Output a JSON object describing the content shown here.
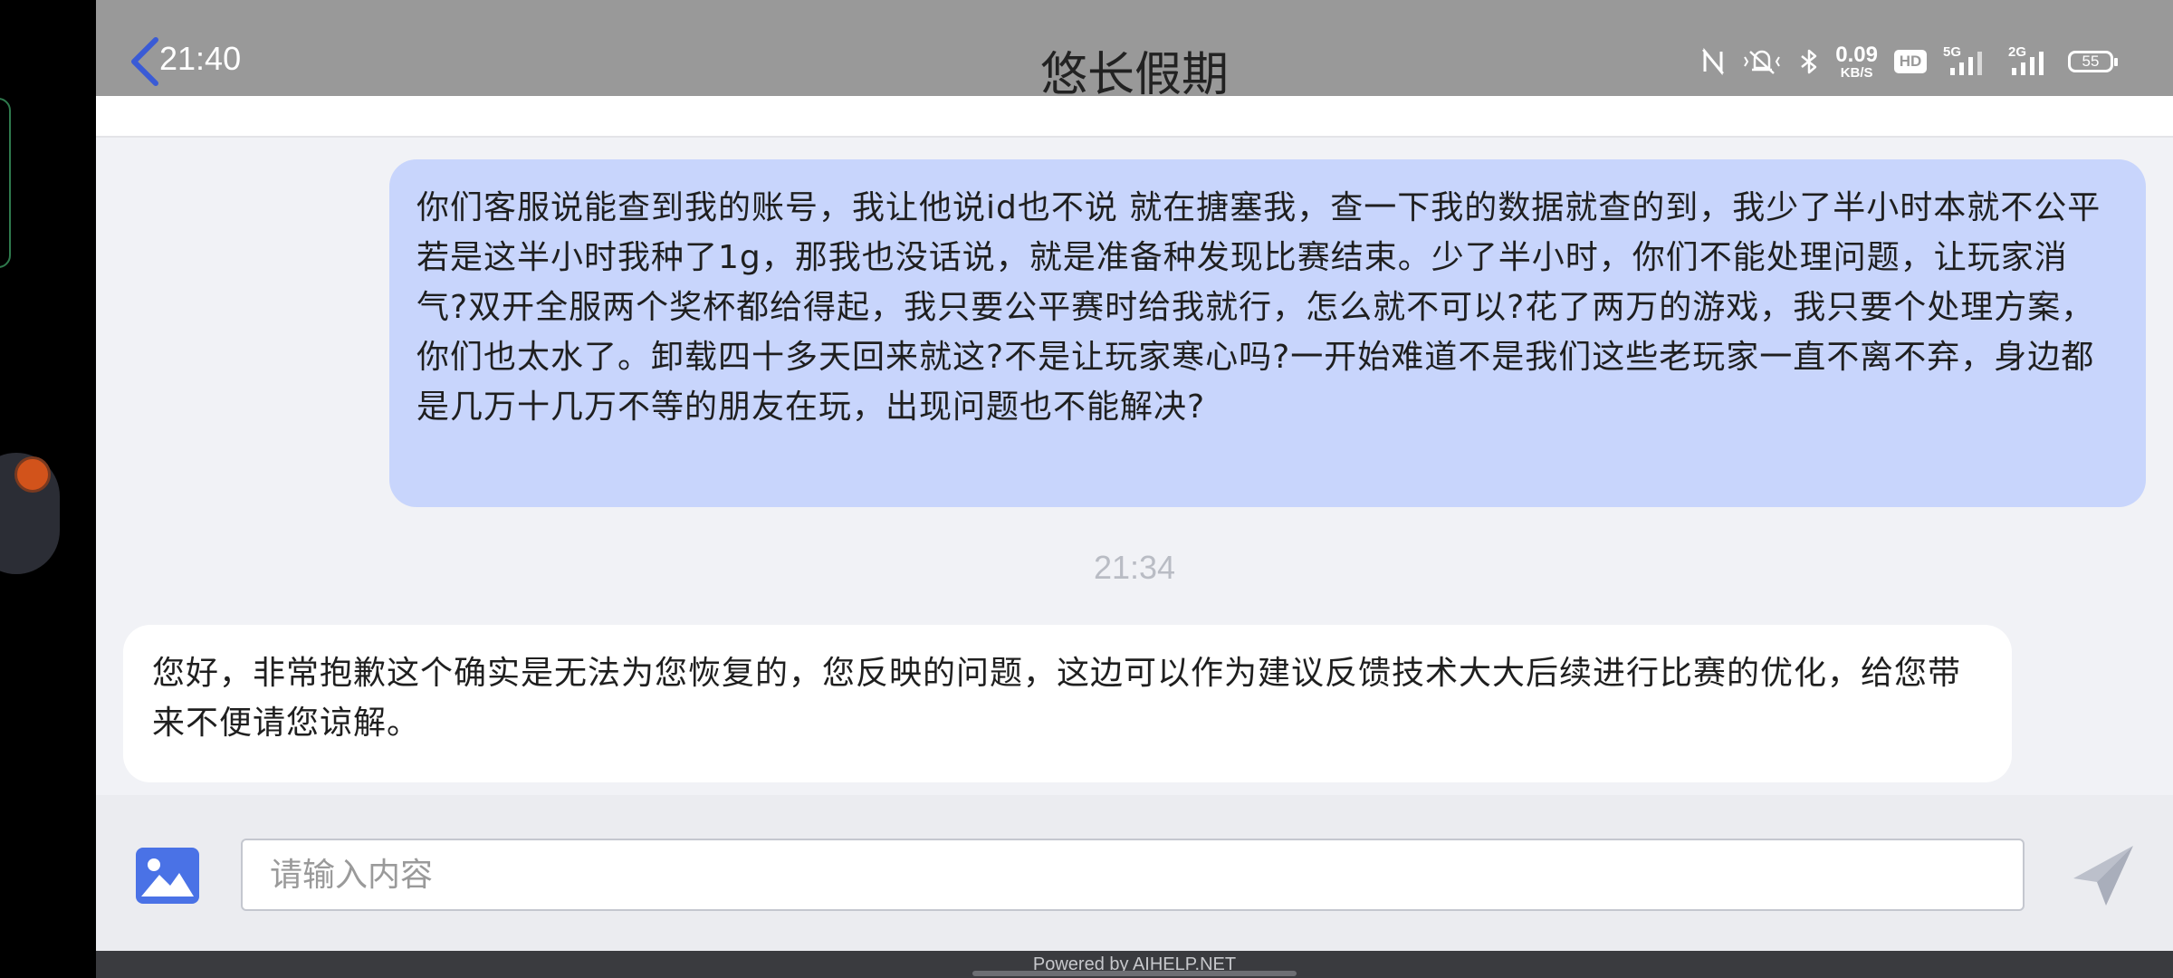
{
  "status_bar": {
    "time": "21:40",
    "net_speed_value": "0.09",
    "net_speed_unit": "KB/S",
    "hd_label": "HD",
    "sim1_label": "5G",
    "sim2_label": "2G",
    "battery": "55"
  },
  "header": {
    "title": "悠长假期"
  },
  "messages": [
    {
      "sender": "user",
      "text": "你们客服说能查到我的账号，我让他说id也不说 就在搪塞我，查一下我的数据就查的到，我少了半小时本就不公平 若是这半小时我种了1g，那我也没话说，就是准备种发现比赛结束。少了半小时，你们不能处理问题，让玩家消气?双开全服两个奖杯都给得起，我只要公平赛时给我就行，怎么就不可以?花了两万的游戏，我只要个处理方案，你们也太水了。卸载四十多天回来就这?不是让玩家寒心吗?一开始难道不是我们这些老玩家一直不离不弃，身边都是几万十几万不等的朋友在玩，出现问题也不能解决?"
    },
    {
      "sender": "agent",
      "text": "您好，非常抱歉这个确实是无法为您恢复的，您反映的问题，这边可以作为建议反馈技术大大后续进行比赛的优化，给您带来不便请您谅解。"
    }
  ],
  "time_separator": "21:34",
  "input": {
    "placeholder": "请输入内容",
    "value": ""
  },
  "footer": {
    "powered_by": "Powered by AIHELP.NET"
  },
  "colors": {
    "header_bg": "#999999",
    "user_bubble": "#c8d5fc",
    "agent_bubble": "#ffffff",
    "chat_bg": "#f1f2f6",
    "accent_blue": "#4a72e6"
  },
  "icons": [
    "back-arrow-icon",
    "nfc-icon",
    "mute-vibrate-icon",
    "bluetooth-icon",
    "signal-icon",
    "battery-icon",
    "image-icon",
    "send-icon"
  ]
}
